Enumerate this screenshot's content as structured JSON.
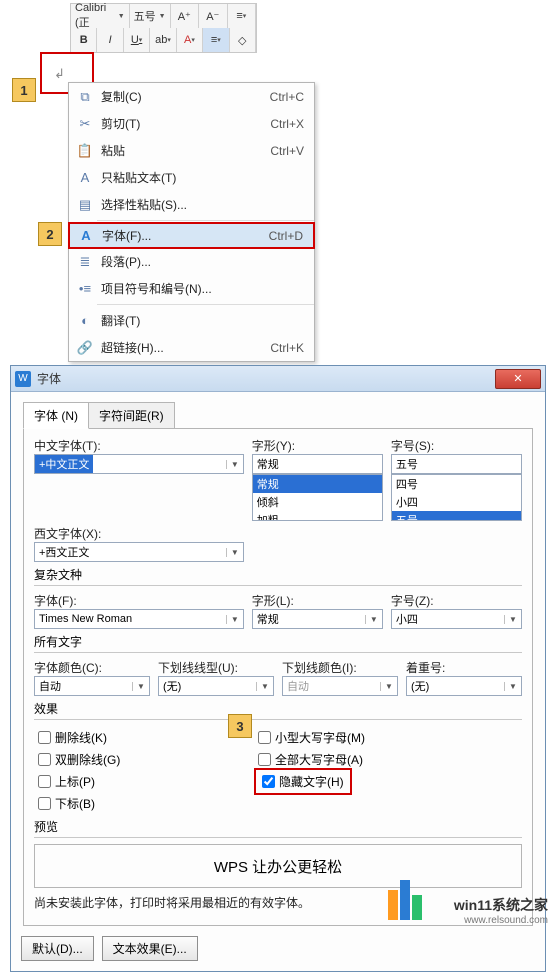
{
  "toolbar": {
    "font_name": "Calibri (正",
    "font_size": "五号",
    "inc_font": "A⁺",
    "dec_font": "A⁻",
    "bold": "B",
    "italic": "I",
    "underline": "U"
  },
  "contextmenu": {
    "items": [
      {
        "label": "复制(C)",
        "shortcut": "Ctrl+C",
        "icon": "⧉"
      },
      {
        "label": "剪切(T)",
        "shortcut": "Ctrl+X",
        "icon": "✂"
      },
      {
        "label": "粘贴",
        "shortcut": "Ctrl+V",
        "icon": "📋"
      },
      {
        "label": "只粘贴文本(T)",
        "shortcut": "",
        "icon": "A"
      },
      {
        "label": "选择性粘贴(S)...",
        "shortcut": "",
        "icon": "▤"
      }
    ],
    "font_item": {
      "label": "字体(F)...",
      "shortcut": "Ctrl+D",
      "icon": "A"
    },
    "items2": [
      {
        "label": "段落(P)...",
        "shortcut": "",
        "icon": "≣"
      },
      {
        "label": "项目符号和编号(N)...",
        "shortcut": "",
        "icon": "•≡"
      },
      {
        "label": "翻译(T)",
        "shortcut": "",
        "icon": "◐"
      },
      {
        "label": "超链接(H)...",
        "shortcut": "Ctrl+K",
        "icon": "🔗"
      }
    ]
  },
  "callouts": {
    "c1": "1",
    "c2": "2",
    "c3": "3"
  },
  "dialog": {
    "title": "字体",
    "tabs": {
      "t1": "字体 (N)",
      "t2": "字符间距(R)"
    },
    "labels": {
      "cn_font": "中文字体(T):",
      "style": "字形(Y):",
      "size": "字号(S):",
      "west_font": "西文字体(X):",
      "complex": "复杂文种",
      "cx_font": "字体(F):",
      "cx_style": "字形(L):",
      "cx_size": "字号(Z):",
      "all_text": "所有文字",
      "font_color": "字体颜色(C):",
      "ul_style": "下划线线型(U):",
      "ul_color": "下划线颜色(I):",
      "emphasis": "着重号:",
      "effects": "效果",
      "strike": "删除线(K)",
      "dstrike": "双删除线(G)",
      "sup": "上标(P)",
      "sub": "下标(B)",
      "smallcaps": "小型大写字母(M)",
      "allcaps": "全部大写字母(A)",
      "hidden": "隐藏文字(H)",
      "preview": "预览",
      "note": "尚未安装此字体，打印时将采用最相近的有效字体。"
    },
    "values": {
      "cn_font": "+中文正文",
      "style": "常规",
      "size": "五号",
      "style_list_1": "常规",
      "style_list_2": "倾斜",
      "style_list_3": "加粗",
      "size_list_1": "四号",
      "size_list_2": "小四",
      "size_list_3": "五号",
      "west_font": "+西文正文",
      "cx_font": "Times New Roman",
      "cx_style": "常规",
      "cx_size": "小四",
      "font_color": "自动",
      "ul_style": "(无)",
      "ul_color": "自动",
      "emphasis": "(无)",
      "preview_text": "WPS 让办公更轻松"
    },
    "buttons": {
      "default": "默认(D)...",
      "text_effects": "文本效果(E)..."
    }
  },
  "watermark": {
    "line1": "win11系统之家",
    "line2": "www.relsound.com"
  }
}
